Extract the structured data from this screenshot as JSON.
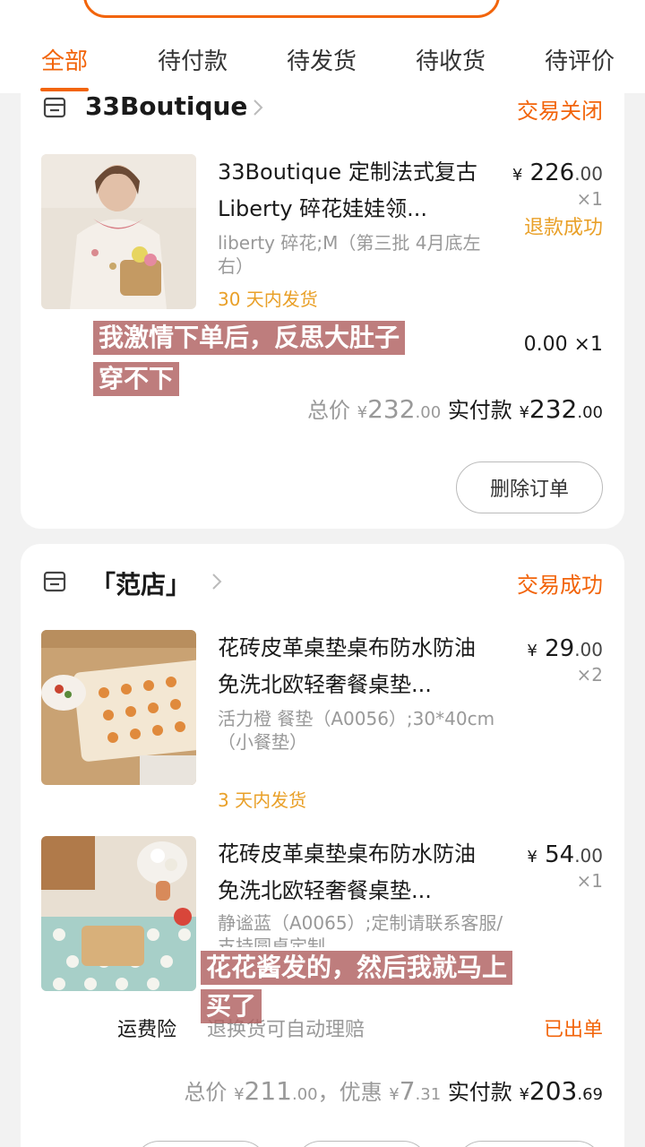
{
  "header": {
    "tabs": [
      "全部",
      "待付款",
      "待发货",
      "待收货",
      "待评价"
    ],
    "active_tab": "全部"
  },
  "orders": [
    {
      "shop_name": "33Boutique",
      "status": "交易关闭",
      "items": [
        {
          "title": "33Boutique 定制法式复古 Liberty 碎花娃娃领...",
          "spec": "liberty 碎花;M（第三批 4月底左右）",
          "shipping": "30 天内发货",
          "price_yen": "¥",
          "price_int": "226",
          "price_dec": ".00",
          "qty": "×1",
          "refund_status": "退款成功"
        }
      ],
      "extra_line": "0.00 ×1",
      "total_label": "总价",
      "total_yen": "¥",
      "total_int": "232",
      "total_dec": ".00",
      "paid_label": "实付款",
      "paid_yen": "¥",
      "paid_int": "232",
      "paid_dec": ".00",
      "button": "删除订单"
    },
    {
      "shop_name": "「范店」",
      "status": "交易成功",
      "items": [
        {
          "title": "花砖皮革桌垫桌布防水防油免洗北欧轻奢餐桌垫...",
          "spec": "活力橙 餐垫（A0056）;30*40cm（小餐垫）",
          "shipping": "3 天内发货",
          "price_yen": "¥",
          "price_int": "29",
          "price_dec": ".00",
          "qty": "×2"
        },
        {
          "title": "花砖皮革桌垫桌布防水防油免洗北欧轻奢餐桌垫...",
          "spec": "静谧蓝（A0065）;定制请联系客服/支持圆桌定制",
          "price_yen": "¥",
          "price_int": "54",
          "price_dec": ".00",
          "qty": "×1"
        }
      ],
      "insurance_label": "运费险",
      "insurance_desc": "退换货可自动理赔",
      "insurance_status": "已出单",
      "total_label": "总价",
      "total_yen": "¥",
      "total_int": "211",
      "total_dec": ".00",
      "discount_label": "，优惠",
      "discount_yen": "¥",
      "discount_int": "7",
      "discount_dec": ".31",
      "paid_label": "实付款",
      "paid_yen": "¥",
      "paid_int": "203",
      "paid_dec": ".69"
    }
  ],
  "subtitles": [
    "我激情下单后，反思大肚子",
    "穿不下",
    "花花酱发的，然后我就马上",
    "买了"
  ],
  "colors": {
    "accent": "#f2640a",
    "shipping": "#e9a028",
    "muted": "#999999",
    "subtitle_bg": "#b06060"
  }
}
